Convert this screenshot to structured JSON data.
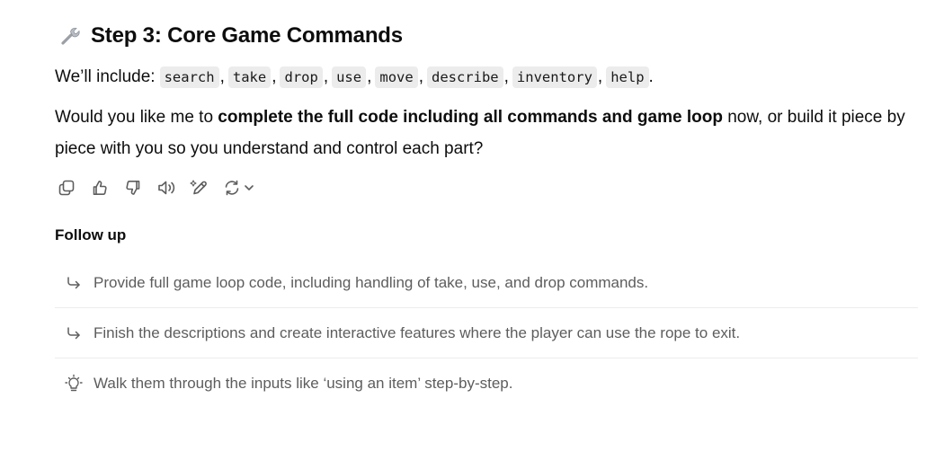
{
  "heading": {
    "icon": "wrench-icon",
    "text": "Step 3: Core Game Commands"
  },
  "commands_sentence": {
    "prefix": "We’ll include:",
    "commands": [
      "search",
      "take",
      "drop",
      "use",
      "move",
      "describe",
      "inventory",
      "help"
    ],
    "separator": ",",
    "end": "."
  },
  "question": {
    "before": "Would you like me to ",
    "bold": "complete the full code including all commands and game loop",
    "after": " now, or build it piece by piece with you so you understand and control each part?"
  },
  "actions": {
    "icons": [
      "copy-icon",
      "thumbs-up-icon",
      "thumbs-down-icon",
      "read-aloud-icon",
      "edit-icon",
      "regenerate-icon",
      "chevron-down-icon"
    ]
  },
  "follow_up": {
    "title": "Follow up",
    "items": [
      {
        "icon": "reply-arrow-icon",
        "text": "Provide full game loop code, including handling of take, use, and drop commands."
      },
      {
        "icon": "reply-arrow-icon",
        "text": "Finish the descriptions and create interactive features where the player can use the rope to exit."
      },
      {
        "icon": "lightbulb-icon",
        "text": "Walk them through the inputs like ‘using an item’ step-by-step."
      }
    ]
  },
  "colors": {
    "text": "#0d0d0d",
    "muted": "#5d5d5d",
    "code_bg": "#ececec",
    "icon": "#5d5d5d"
  }
}
